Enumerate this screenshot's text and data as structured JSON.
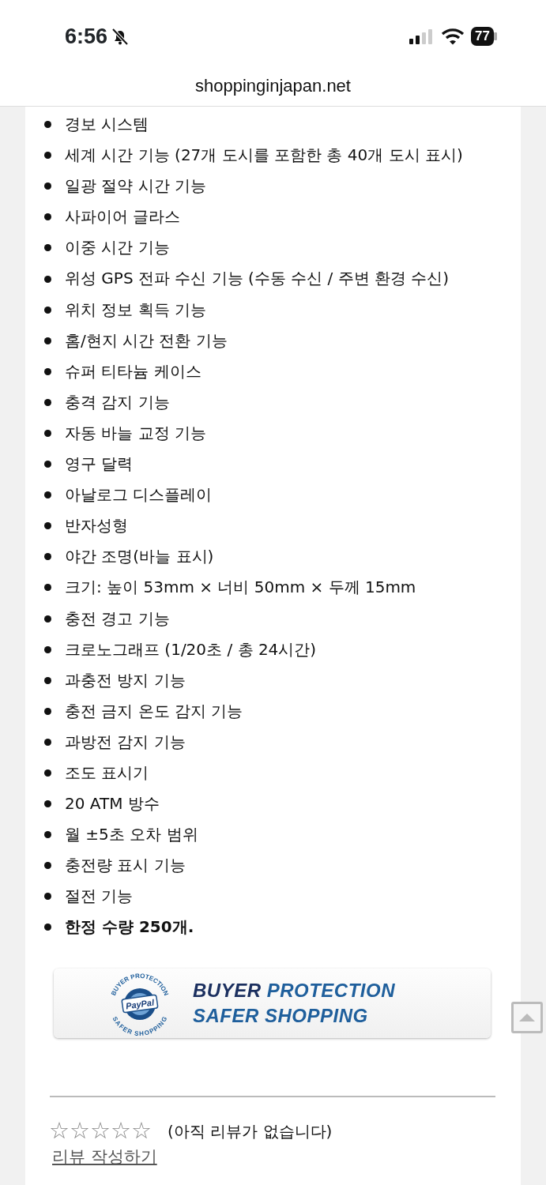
{
  "status_bar": {
    "time": "6:56",
    "battery": "77"
  },
  "address_bar": {
    "url": "shoppinginjapan.net"
  },
  "features": [
    {
      "text": "경보 시스템",
      "bold": false
    },
    {
      "text": "세계 시간 기능 (27개 도시를 포함한 총 40개 도시 표시)",
      "bold": false
    },
    {
      "text": "일광 절약 시간 기능",
      "bold": false
    },
    {
      "text": "사파이어 글라스",
      "bold": false
    },
    {
      "text": "이중 시간 기능",
      "bold": false
    },
    {
      "text": "위성 GPS 전파 수신 기능 (수동 수신 / 주변 환경 수신)",
      "bold": false
    },
    {
      "text": "위치 정보 획득 기능",
      "bold": false
    },
    {
      "text": "홈/현지 시간 전환 기능",
      "bold": false
    },
    {
      "text": "슈퍼 티타늄 케이스",
      "bold": false
    },
    {
      "text": "충격 감지 기능",
      "bold": false
    },
    {
      "text": "자동 바늘 교정 기능",
      "bold": false
    },
    {
      "text": "영구 달력",
      "bold": false
    },
    {
      "text": "아날로그 디스플레이",
      "bold": false
    },
    {
      "text": "반자성형",
      "bold": false
    },
    {
      "text": "야간 조명(바늘 표시)",
      "bold": false
    },
    {
      "text": "크기: 높이 53mm × 너비 50mm × 두께 15mm",
      "bold": false
    },
    {
      "text": "충전 경고 기능",
      "bold": false
    },
    {
      "text": "크로노그래프 (1/20초 / 총 24시간)",
      "bold": false
    },
    {
      "text": "과충전 방지 기능",
      "bold": false
    },
    {
      "text": "충전 금지 온도 감지 기능",
      "bold": false
    },
    {
      "text": "과방전 감지 기능",
      "bold": false
    },
    {
      "text": "조도 표시기",
      "bold": false
    },
    {
      "text": "20 ATM 방수",
      "bold": false
    },
    {
      "text": "월 ±5초 오차 범위",
      "bold": false
    },
    {
      "text": "충전량 표시 기능",
      "bold": false
    },
    {
      "text": "절전 기능",
      "bold": false
    },
    {
      "text": "한정 수량 250개.",
      "bold": true
    }
  ],
  "banner": {
    "seal": {
      "top_text": "BUYER PROTECTION",
      "brand": "PayPal",
      "bottom_text": "SAFER SHOPPING"
    },
    "headline": [
      [
        {
          "text": "BUYER",
          "color": "#1b2f5f"
        },
        {
          "text": "PROTECTION",
          "color": "#1f5f9c"
        }
      ],
      [
        {
          "text": "SAFER SHOPPING",
          "color": "#1f5f9c"
        }
      ]
    ]
  },
  "reviews": {
    "stars": 0,
    "summary": "(아직 리뷰가 없습니다)",
    "write_link": "리뷰 작성하기"
  }
}
